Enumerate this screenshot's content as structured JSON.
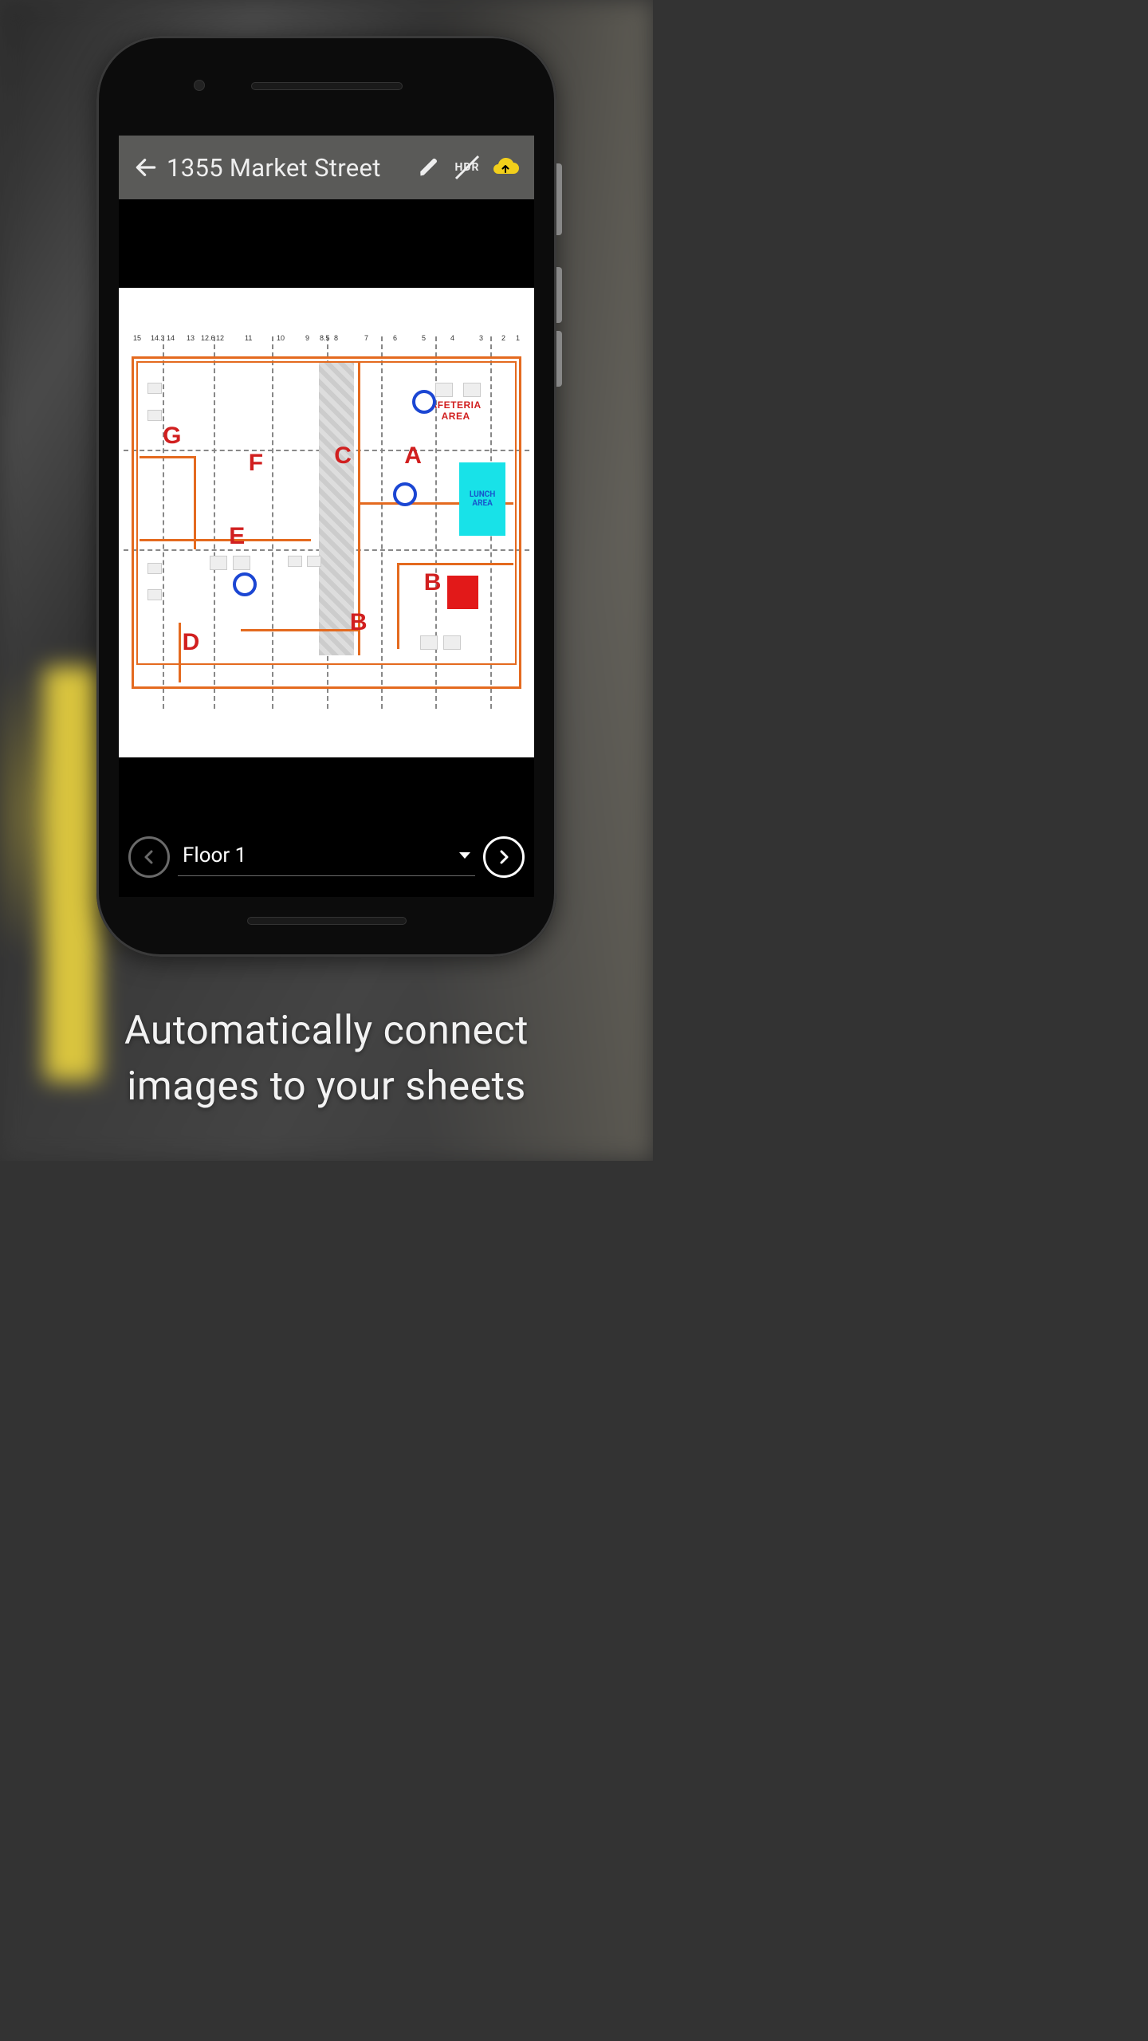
{
  "header": {
    "title": "1355 Market Street"
  },
  "toolbar": {
    "hdr_label": "HDR"
  },
  "floorplan": {
    "column_ticks": [
      "15",
      "14.3",
      "14",
      "13",
      "12.6",
      "12",
      "11",
      "10",
      "9",
      "8.5",
      "8",
      "7",
      "6",
      "5",
      "4",
      "3",
      "2",
      "1"
    ],
    "zone_labels": {
      "A": "A",
      "B": "B",
      "B2": "B",
      "C": "C",
      "D": "D",
      "E": "E",
      "F": "F",
      "G": "G"
    },
    "text_labels": {
      "cafeteria": "AFETERIA AREA",
      "lunch": "LUNCH AREA"
    },
    "markers": [
      {
        "id": "marker-1"
      },
      {
        "id": "marker-2"
      },
      {
        "id": "marker-3"
      }
    ]
  },
  "bottombar": {
    "selected_floor": "Floor 1"
  },
  "caption": {
    "line1": "Automatically connect",
    "line2": "images to your sheets"
  },
  "colors": {
    "accent_upload": "#f2cf1b",
    "zone_red": "#d11f1f",
    "plan_orange": "#e46a1f",
    "marker_blue": "#1b46d3",
    "lunch_cyan": "#18e2e8"
  }
}
